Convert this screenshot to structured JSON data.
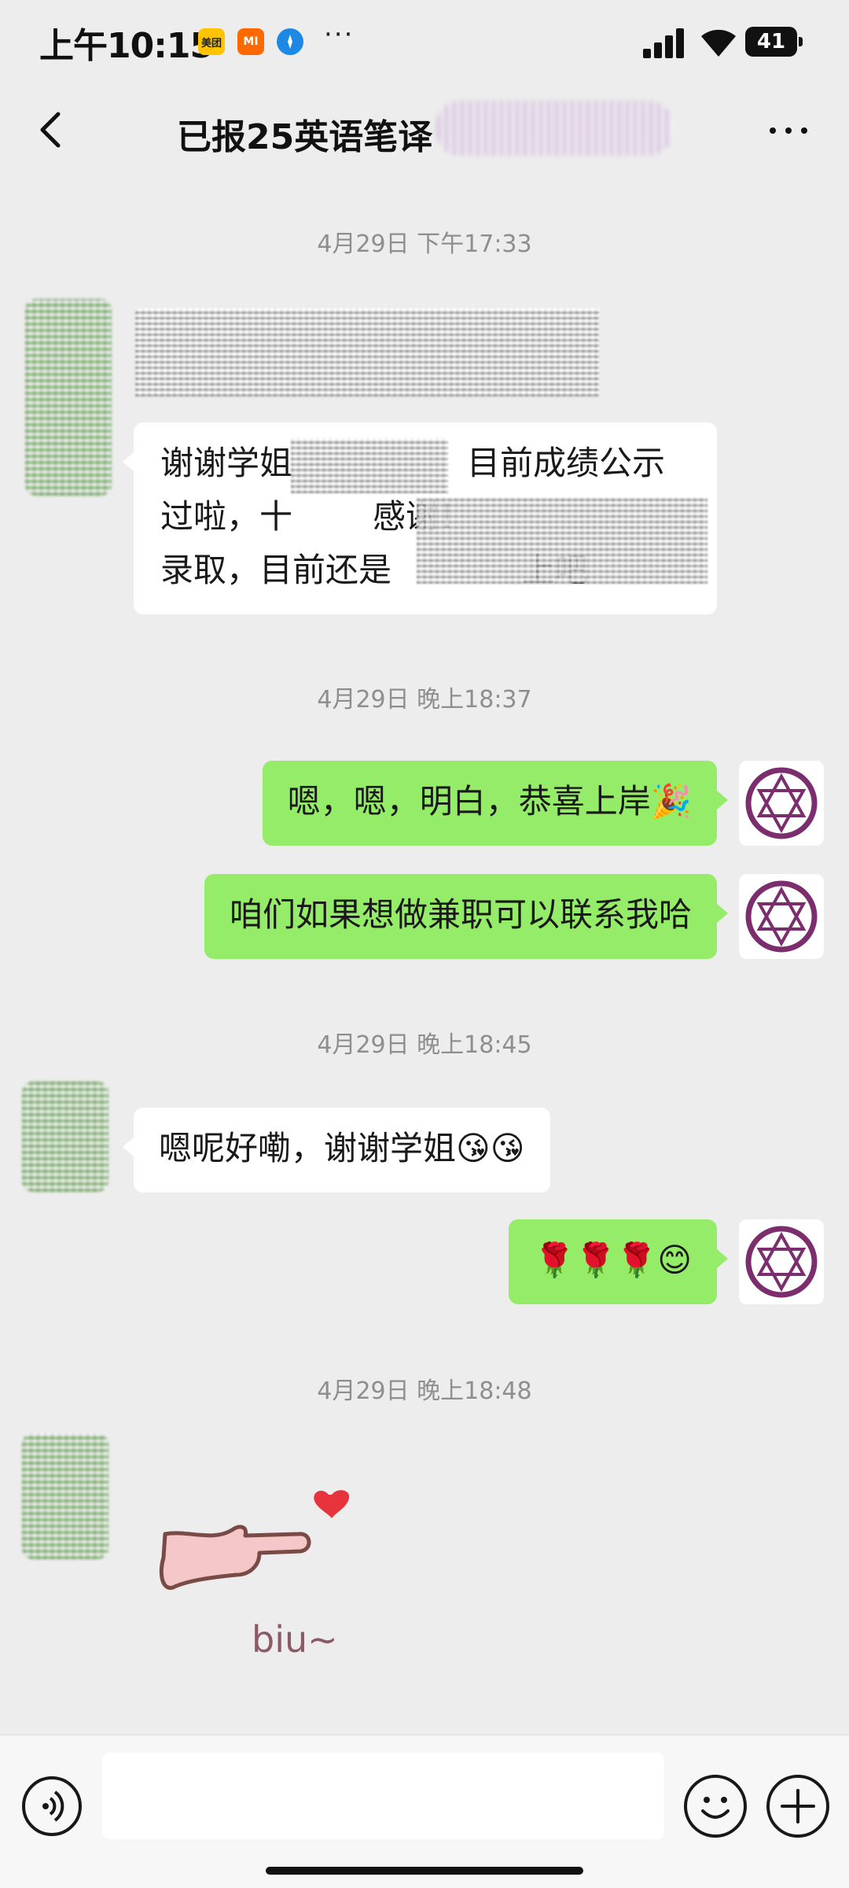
{
  "status_bar": {
    "time": "上午10:15",
    "badges": [
      "美团",
      "MI",
      ""
    ],
    "more": "···",
    "battery": "41"
  },
  "nav": {
    "title": "已报25英语笔译"
  },
  "timestamps": [
    "4月29日 下午17:33",
    "4月29日 晚上18:37",
    "4月29日 晚上18:45",
    "4月29日 晚上18:48"
  ],
  "messages": {
    "in_1_line1": "谢谢学姐",
    "in_1_line1b": "目前成绩公示",
    "in_1_line2": "过啦，十",
    "in_1_line2b": "感谢！",
    "in_1_line3": "录取，目前还是",
    "in_1_line3b": "上吧",
    "out_1": "嗯，嗯，明白，恭喜上岸🎉",
    "out_2": "咱们如果想做兼职可以联系我哈",
    "in_2": "嗯呢好嘞，谢谢学姐😘😘",
    "out_3": "🌹🌹🌹😊",
    "sticker_text": "biu~"
  },
  "input": {
    "placeholder": ""
  },
  "colors": {
    "background": "#ededed",
    "bubble_out": "#95ec69",
    "bubble_in": "#ffffff",
    "avatar_accent": "#7b2d6e"
  },
  "icons": [
    "back-icon",
    "more-icon",
    "voice-icon",
    "emoji-icon",
    "plus-icon"
  ]
}
